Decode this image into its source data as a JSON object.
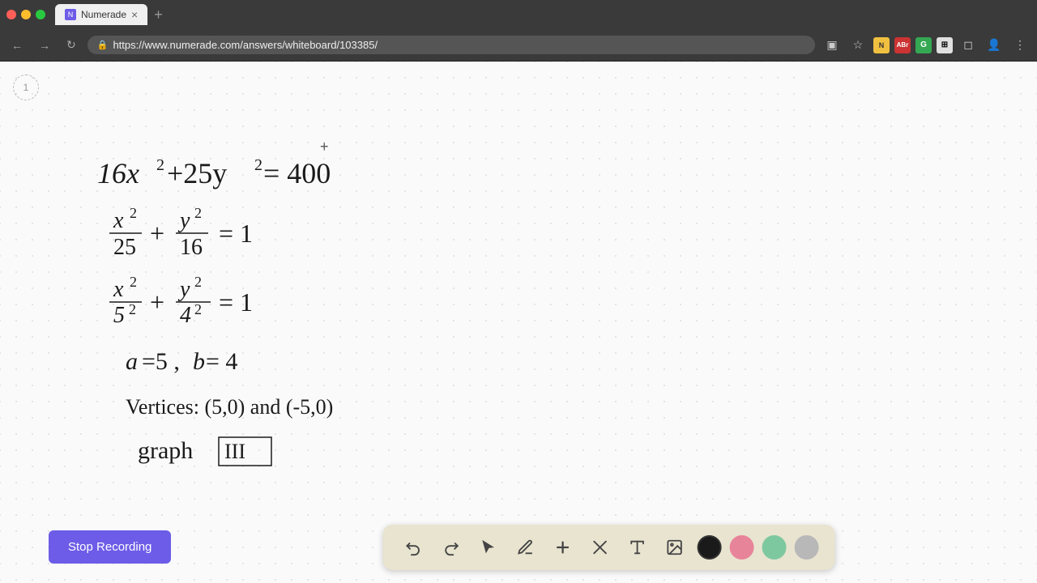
{
  "browser": {
    "title": "Numerade",
    "url": "https://www.numerade.com/answers/whiteboard/103385/",
    "tab_favicon": "N",
    "tab_close": "×",
    "new_tab": "+"
  },
  "nav": {
    "back": "‹",
    "forward": "›",
    "reload": "↺",
    "lock_icon": "🔒"
  },
  "browser_actions": {
    "screen_capture": "▣",
    "bookmark": "☆",
    "extensions": [
      "",
      "ABr",
      "",
      "",
      "⊞",
      "◻",
      "👤",
      "⋮"
    ]
  },
  "page": {
    "number": "1"
  },
  "math": {
    "line1": "16x² + 25y² = 400",
    "line2a": "x²",
    "line2b": "25",
    "line2c": "y²",
    "line2d": "16",
    "line3a": "x²",
    "line3b": "5²",
    "line3c": "y²",
    "line3d": "4²",
    "line4": "a = 5, b = 4",
    "line5": "Vertices: (5,0) and (-5,0)",
    "line6a": "graph",
    "line6b": "III"
  },
  "toolbar": {
    "undo_label": "↺",
    "redo_label": "↻",
    "select_label": "➤",
    "pen_label": "✏",
    "plus_label": "+",
    "eraser_label": "/",
    "text_label": "A",
    "image_label": "🖼",
    "colors": {
      "black": "#1a1a1a",
      "pink": "#e8849a",
      "green": "#7ec8a0",
      "gray": "#b0b0b0"
    }
  },
  "stop_recording": {
    "label": "Stop Recording"
  }
}
